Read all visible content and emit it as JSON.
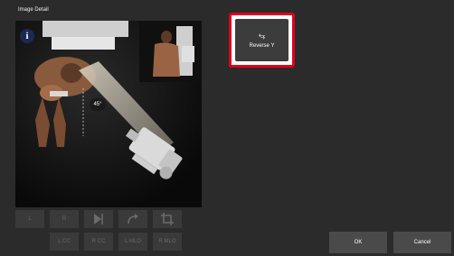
{
  "window": {
    "title": "Image Detail"
  },
  "viewer": {
    "info_icon": "i",
    "angle": "45°"
  },
  "toolbar": {
    "row1": [
      {
        "id": "L",
        "label": "L",
        "icon": "none"
      },
      {
        "id": "R",
        "label": "R",
        "icon": "none"
      },
      {
        "id": "flip",
        "label": "",
        "icon": "flip-icon"
      },
      {
        "id": "rotate",
        "label": "",
        "icon": "rotate-icon"
      },
      {
        "id": "crop",
        "label": "",
        "icon": "crop-icon"
      }
    ],
    "row2": [
      {
        "id": "LCC",
        "label": "L CC"
      },
      {
        "id": "RCC",
        "label": "R CC"
      },
      {
        "id": "LMLO",
        "label": "L MLO"
      },
      {
        "id": "RMLO",
        "label": "R MLO"
      }
    ]
  },
  "reverse_y": {
    "label": "Reverse Y",
    "icon": "reverse-icon",
    "icon_glyph": "⥃"
  },
  "actions": {
    "ok": "OK",
    "cancel": "Cancel"
  },
  "colors": {
    "highlight": "#e0001b",
    "background": "#2b2b2b",
    "button": "#4a4a4a"
  }
}
